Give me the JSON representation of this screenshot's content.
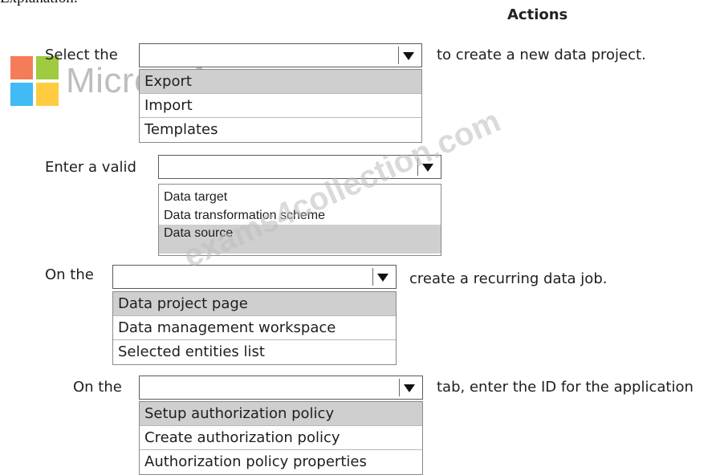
{
  "header": {
    "explanation": "Explanation:",
    "actions": "Actions"
  },
  "watermarks": {
    "logo_text": "Microsoft",
    "site": "exams4collection.com"
  },
  "steps": [
    {
      "prefix": "Select the",
      "suffix": "to create a new data project.",
      "options": [
        "Export",
        "Import",
        "Templates"
      ],
      "selected": "Export"
    },
    {
      "prefix": "Enter a valid",
      "suffix": "",
      "options": [
        "Data target",
        "Data transformation scheme",
        "Data source"
      ],
      "selected": "Data source"
    },
    {
      "prefix": "On the",
      "suffix": "create a recurring data job.",
      "options": [
        "Data project page",
        "Data management workspace",
        "Selected entities list"
      ],
      "selected": "Data project page"
    },
    {
      "prefix": "On the",
      "suffix": "tab, enter the ID for the application",
      "options": [
        "Setup authorization policy",
        "Create authorization policy",
        "Authorization policy properties"
      ],
      "selected": "Setup authorization policy"
    }
  ],
  "colors": {
    "selected_option_bg": "#cfcfcf",
    "logo_red": "#f25022",
    "logo_green": "#7fba00",
    "logo_blue": "#00a4ef",
    "logo_yellow": "#ffb900"
  }
}
